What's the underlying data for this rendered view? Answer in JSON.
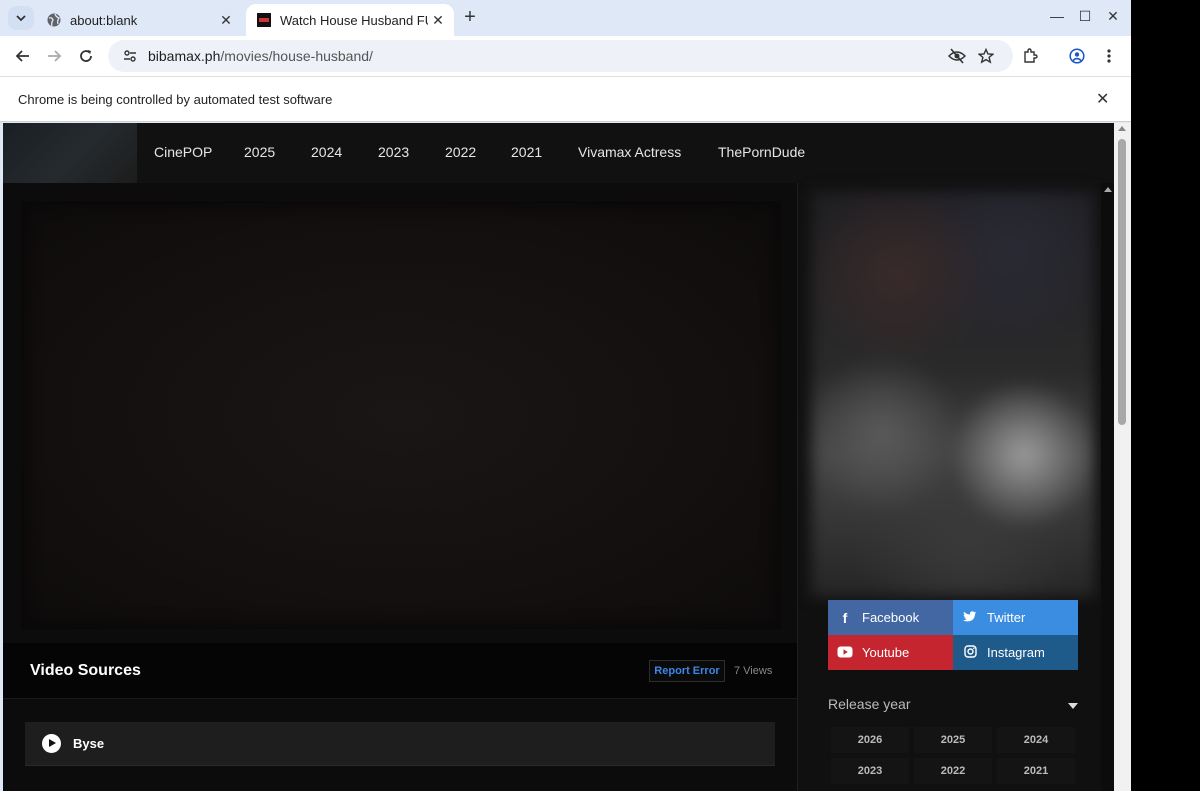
{
  "browser": {
    "tabs": [
      {
        "title": "about:blank",
        "active": false
      },
      {
        "title": "Watch House Husband FU",
        "active": true
      }
    ],
    "url_host": "bibamax.ph",
    "url_path": "/movies/house-husband/",
    "infobar_message": "Chrome is being controlled by automated test software",
    "icons": [
      "chevron-down-icon",
      "globe-icon",
      "close-icon",
      "plus-icon",
      "minimize-icon",
      "maximize-icon",
      "back-icon",
      "forward-icon",
      "reload-icon",
      "site-info-icon",
      "eye-off-icon",
      "star-icon",
      "extensions-icon",
      "profile-icon",
      "menu-icon"
    ]
  },
  "site": {
    "nav": [
      "CinePOP",
      "2025",
      "2024",
      "2023",
      "2022",
      "2021",
      "Vivamax Actress",
      "ThePornDude"
    ],
    "sources_title": "Video Sources",
    "report_label": "Report Error",
    "views": "7 Views",
    "source_label": "Byse",
    "social": {
      "facebook": "Facebook",
      "twitter": "Twitter",
      "youtube": "Youtube",
      "instagram": "Instagram"
    },
    "release_label": "Release year",
    "years": [
      "2026",
      "2025",
      "2024",
      "2023",
      "2022",
      "2021"
    ],
    "colors": {
      "facebook": "#4267a2",
      "twitter": "#3b8de2",
      "youtube": "#c4252f",
      "instagram": "#1e5a8a",
      "report": "#3c87e6"
    }
  }
}
